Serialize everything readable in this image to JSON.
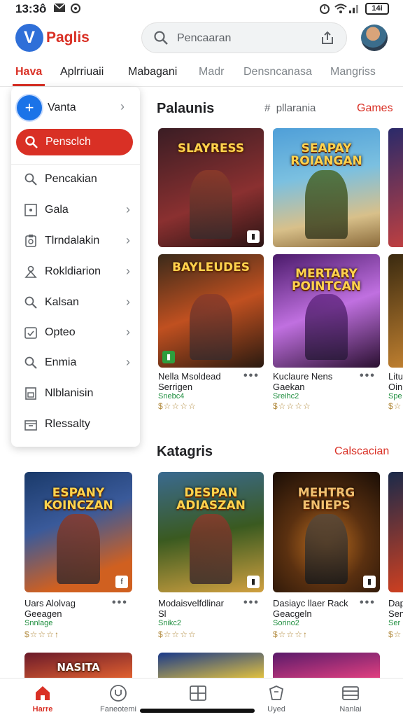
{
  "status": {
    "time": "13:3ô",
    "battery": "14i"
  },
  "header": {
    "logo_letter": "V",
    "app_name": "Paglis",
    "search_placeholder": "Pencaaran"
  },
  "tabs": [
    {
      "label": "Hava"
    },
    {
      "label": "Aplrriuaii"
    },
    {
      "label": "Mabagani"
    },
    {
      "label": "Madr"
    },
    {
      "label": "Densncanasa"
    },
    {
      "label": "Mangriss"
    }
  ],
  "menu": {
    "top_label": "Vanta",
    "cta_label": "Pensclch",
    "items": [
      {
        "label": "Pencakian",
        "icon": "search-icon",
        "chevron": false
      },
      {
        "label": "Gala",
        "icon": "square-dot-icon",
        "chevron": true
      },
      {
        "label": "Tlrndalakin",
        "icon": "clipboard-icon",
        "chevron": true
      },
      {
        "label": "Rokldiarion",
        "icon": "person-icon",
        "chevron": true
      },
      {
        "label": "Kalsan",
        "icon": "search-icon",
        "chevron": true
      },
      {
        "label": "Opteo",
        "icon": "checklist-icon",
        "chevron": true
      },
      {
        "label": "Enmia",
        "icon": "search-icon",
        "chevron": true
      },
      {
        "label": "Nlblanisin",
        "icon": "document-icon",
        "chevron": false
      },
      {
        "label": "Rlessalty",
        "icon": "box-icon",
        "chevron": false
      }
    ]
  },
  "section1": {
    "title": "Palaunis",
    "hash_label": "pllarania",
    "link": "Games"
  },
  "row1": [
    {
      "banner": "SLAYRESS",
      "colors": [
        "#3a1d24",
        "#8a3030"
      ]
    },
    {
      "banner": "SEAPAY ROIANGAN",
      "colors": [
        "#4f9fd8",
        "#d8c08a"
      ]
    },
    {
      "banner": "",
      "colors": [
        "#2a2a6a",
        "#c04040"
      ]
    }
  ],
  "row2": [
    {
      "banner": "BAYLEUDES",
      "colors": [
        "#3a2a1a",
        "#c05020"
      ],
      "title": "Nella Msoldead",
      "title2": "Serrigen",
      "sub": "Snebc4",
      "stars": "$☆☆☆☆"
    },
    {
      "banner": "MERTARY POINTCAN",
      "colors": [
        "#4a1a6a",
        "#c070e0"
      ],
      "title": "Kuclaure Nens",
      "title2": "Gaekan",
      "sub": "Sreihc2",
      "stars": "$☆☆☆☆"
    },
    {
      "banner": "",
      "colors": [
        "#3a2a10",
        "#c08030"
      ],
      "title": "Litu",
      "title2": "Oin",
      "sub": "Spe",
      "stars": "$☆"
    }
  ],
  "section2": {
    "title": "Katagris",
    "link": "Calscacian"
  },
  "row3": [
    {
      "banner": "ESPANY KOINCZAN",
      "colors": [
        "#1a3a6a",
        "#d06020"
      ],
      "title": "Uars Alolvag",
      "title2": "Geeagen",
      "sub": "Snnlage",
      "stars": "$☆☆☆↑"
    },
    {
      "banner": "DESPAN ADIASZAN",
      "colors": [
        "#3a5a20",
        "#d0a040"
      ],
      "title": "Modaisvelfdlinar",
      "title2": "Sl",
      "sub": "Snikc2",
      "stars": "$☆☆☆☆"
    },
    {
      "banner": "MEHTRG ENIEPS",
      "colors": [
        "#2a1a0a",
        "#c07020"
      ],
      "title": "Dasiayc llaer Rack",
      "title2": "Geacgeln",
      "sub": "Sorino2",
      "stars": "$☆☆☆↑"
    },
    {
      "banner": "",
      "colors": [
        "#1a2a4a",
        "#d04020"
      ],
      "title": "Dap",
      "title2": "Sen",
      "sub": "Ser",
      "stars": "$☆"
    }
  ],
  "row4": [
    {
      "banner": "NASITA",
      "colors": [
        "#6a1a2a",
        "#e06030"
      ]
    },
    {
      "banner": "",
      "colors": [
        "#1a3a8a",
        "#e0c040"
      ]
    },
    {
      "banner": "",
      "colors": [
        "#5a1a6a",
        "#e04080"
      ]
    }
  ],
  "bottom_nav": [
    {
      "label": "Harre",
      "icon": "home-icon"
    },
    {
      "label": "Faneotemi",
      "icon": "circle-icon"
    },
    {
      "label": "",
      "icon": "grid-icon"
    },
    {
      "label": "Uyed",
      "icon": "shield-icon"
    },
    {
      "label": "Nanlai",
      "icon": "library-icon"
    }
  ],
  "colors": {
    "accent": "#d93025",
    "blue": "#1a73e8",
    "rating_green": "#1e8e3e"
  }
}
